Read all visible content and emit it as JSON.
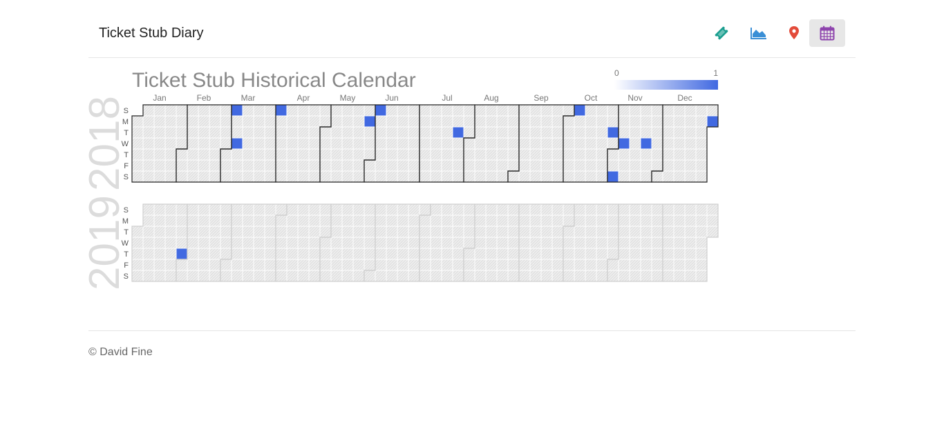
{
  "navbar": {
    "brand": "Ticket Stub Diary",
    "icons": [
      {
        "name": "ticket-icon",
        "color": "#1a9e8f",
        "active": false
      },
      {
        "name": "area-chart-icon",
        "color": "#3a8fd6",
        "active": false
      },
      {
        "name": "map-marker-icon",
        "color": "#e34b3a",
        "active": false
      },
      {
        "name": "calendar-icon",
        "color": "#8e44ad",
        "active": true
      }
    ]
  },
  "footer": {
    "text": "© David Fine"
  },
  "chart_data": {
    "type": "heatmap",
    "title": "Ticket Stub Historical Calendar",
    "legend": {
      "min": "0",
      "max": "1",
      "min_color": "#ffffff",
      "max_color": "#4169e1",
      "placement": "top-right"
    },
    "fill_color": "#4169e1",
    "month_labels": [
      "Jan",
      "Feb",
      "Mar",
      "Apr",
      "May",
      "Jun",
      "Jul",
      "Aug",
      "Sep",
      "Oct",
      "Nov",
      "Dec"
    ],
    "day_labels": [
      "S",
      "M",
      "T",
      "W",
      "T",
      "F",
      "S"
    ],
    "years": [
      {
        "year": "2018",
        "highlighted": true,
        "events": [
          {
            "date": "2018-03-04",
            "value": 1
          },
          {
            "date": "2018-03-07",
            "value": 1
          },
          {
            "date": "2018-04-01",
            "value": 1
          },
          {
            "date": "2018-05-28",
            "value": 1
          },
          {
            "date": "2018-06-03",
            "value": 1
          },
          {
            "date": "2018-07-24",
            "value": 1
          },
          {
            "date": "2018-10-07",
            "value": 1
          },
          {
            "date": "2018-10-30",
            "value": 1
          },
          {
            "date": "2018-11-03",
            "value": 1
          },
          {
            "date": "2018-11-07",
            "value": 1
          },
          {
            "date": "2018-11-21",
            "value": 1
          },
          {
            "date": "2018-12-31",
            "value": 1
          }
        ]
      },
      {
        "year": "2019",
        "highlighted": false,
        "events": [
          {
            "date": "2019-01-31",
            "value": 1
          }
        ]
      }
    ]
  }
}
